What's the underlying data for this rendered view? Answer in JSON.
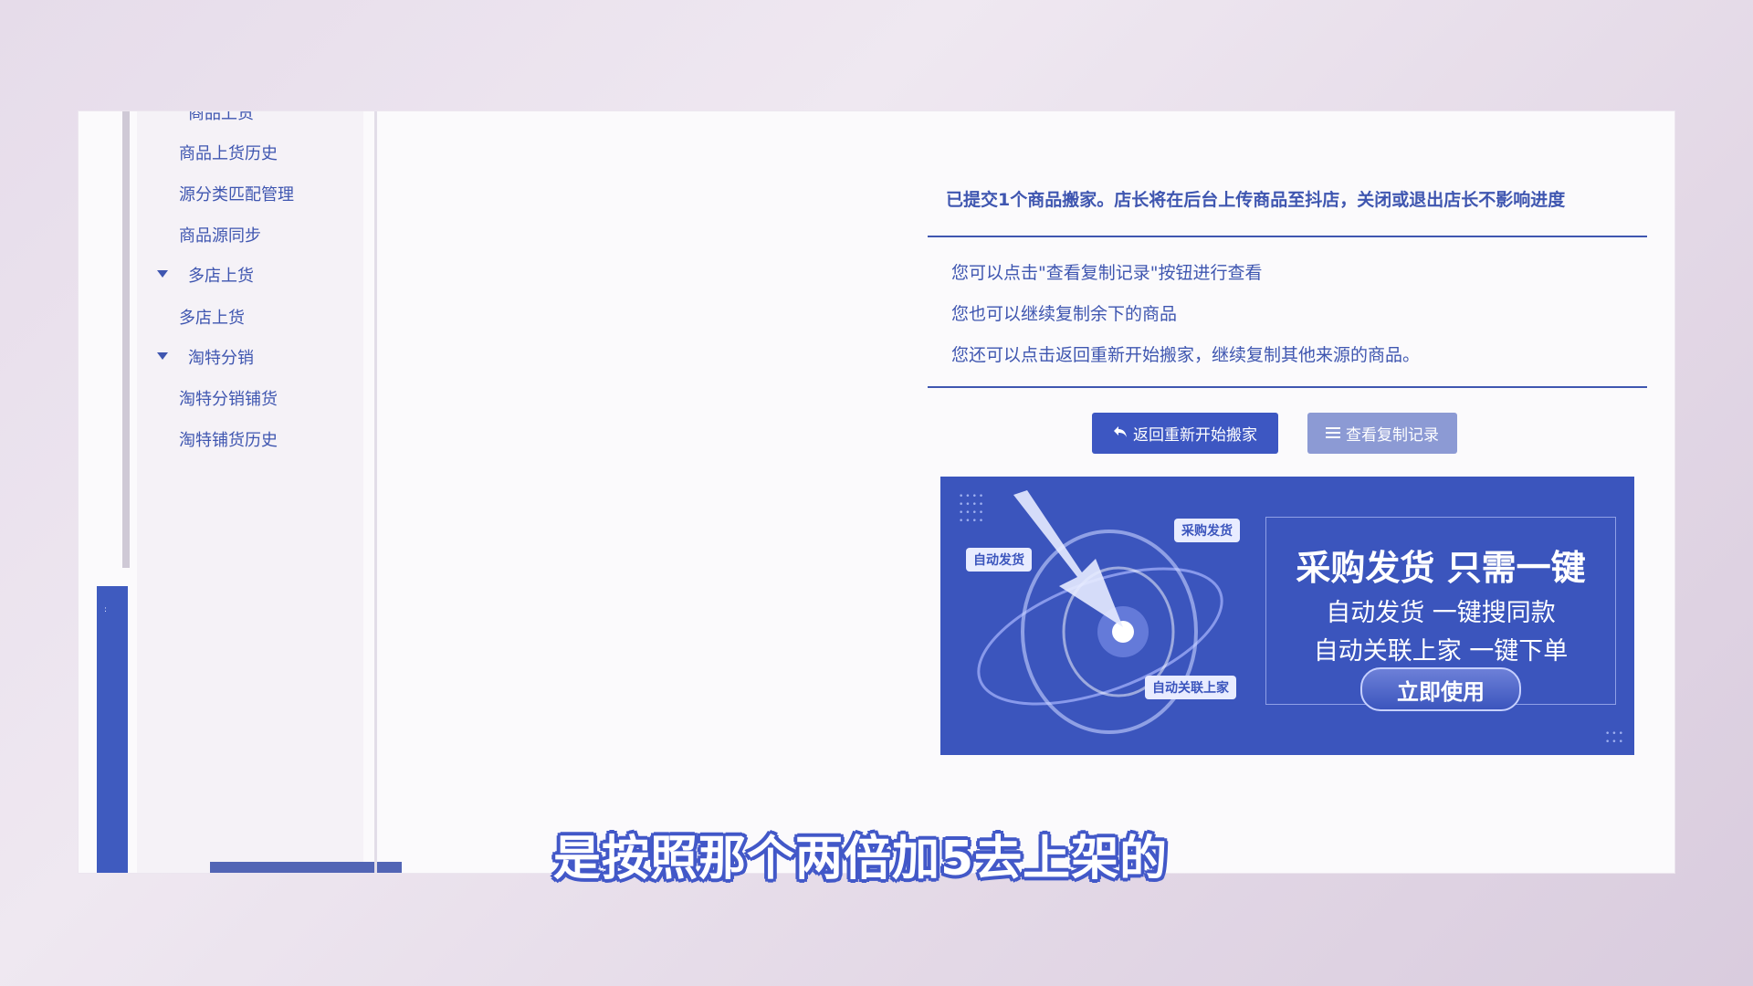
{
  "sidebar": {
    "partial_top_label": "商品上货",
    "items": [
      {
        "label": "商品上货历史"
      },
      {
        "label": "源分类匹配管理"
      },
      {
        "label": "商品源同步"
      }
    ],
    "groups": [
      {
        "label": "多店上货",
        "items": [
          {
            "label": "多店上货"
          }
        ]
      },
      {
        "label": "淘特分销",
        "items": [
          {
            "label": "淘特分销铺货"
          },
          {
            "label": "淘特铺货历史"
          }
        ]
      }
    ]
  },
  "main": {
    "message_title": "已提交1个商品搬家。店长将在后台上传商品至抖店，关闭或退出店长不影响进度",
    "lines": [
      "您可以点击\"查看复制记录\"按钮进行查看",
      "您也可以继续复制余下的商品",
      "您还可以点击返回重新开始搬家，继续复制其他来源的商品。"
    ],
    "buttons": {
      "back_label": "返回重新开始搬家",
      "record_label": "查看复制记录"
    }
  },
  "banner": {
    "tag_auto_ship": "自动发货",
    "tag_purchase_ship": "采购发货",
    "tag_auto_link": "自动关联上家",
    "headline": "采购发货 只需一键",
    "sub1": "自动发货 一键搜同款",
    "sub2": "自动关联上家 一键下单",
    "cta": "立即使用"
  },
  "subtitle": "是按照那个两倍加5去上架的",
  "colors": {
    "accent": "#3f56b0",
    "banner_bg": "#3b55bd",
    "button_primary": "#3d57c2",
    "button_secondary": "#8c9ad4"
  },
  "icons": {
    "back_button_icon": "return-arrow-icon",
    "record_button_icon": "list-icon",
    "group_expand_icon": "caret-down-icon"
  }
}
